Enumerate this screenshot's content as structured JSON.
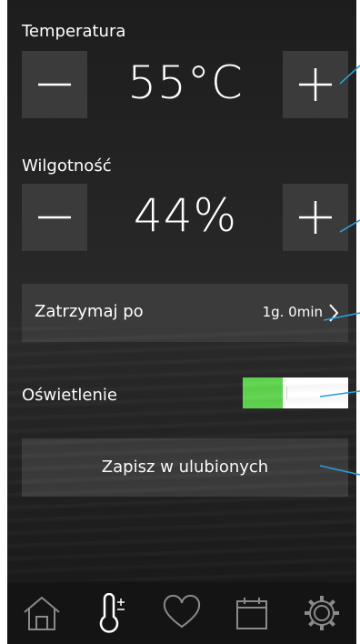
{
  "temperature": {
    "label": "Temperatura",
    "value": "55°C"
  },
  "humidity": {
    "label": "Wilgotność",
    "value": "44%"
  },
  "stop_after": {
    "label": "Zatrzymaj po",
    "value": "1g. 0min"
  },
  "lighting": {
    "label": "Oświetlenie",
    "state": "on"
  },
  "save_favorite": {
    "label": "Zapisz w ulubionych"
  },
  "colors": {
    "accent": "#5fd44f",
    "callout": "#2a9fd8",
    "button_bg": "#3b3b3b"
  },
  "nav": {
    "items": [
      {
        "icon": "home-icon"
      },
      {
        "icon": "thermometer-plus-icon",
        "active": true
      },
      {
        "icon": "heart-icon"
      },
      {
        "icon": "calendar-icon"
      },
      {
        "icon": "gear-icon"
      }
    ]
  }
}
